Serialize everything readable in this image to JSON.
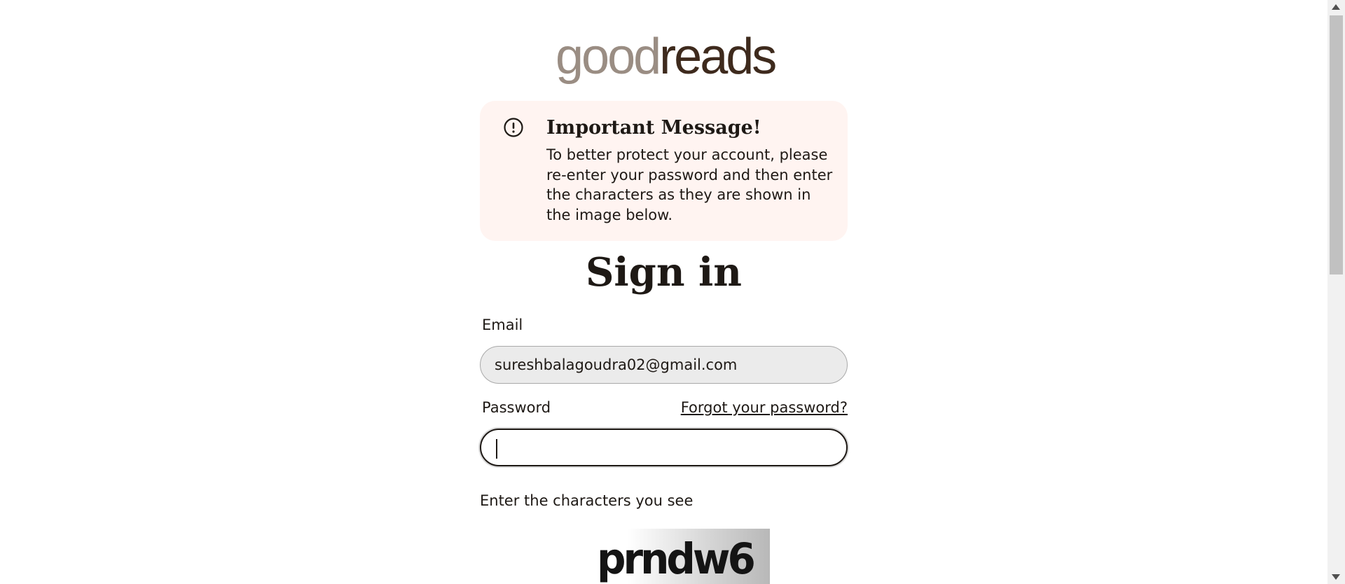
{
  "logo": {
    "part1": "good",
    "part2": "reads"
  },
  "alert": {
    "icon": "exclamation-circle-icon",
    "title": "Important Message!",
    "body": "To better protect your account, please re-enter your password and then enter the characters as they are shown in the image below."
  },
  "form": {
    "title": "Sign in",
    "email_label": "Email",
    "email_value": "sureshbalagoudra02@gmail.com",
    "password_label": "Password",
    "forgot_link": "Forgot your password?",
    "password_value": "",
    "captcha_label": "Enter the characters you see",
    "captcha_text": "prndw6"
  }
}
